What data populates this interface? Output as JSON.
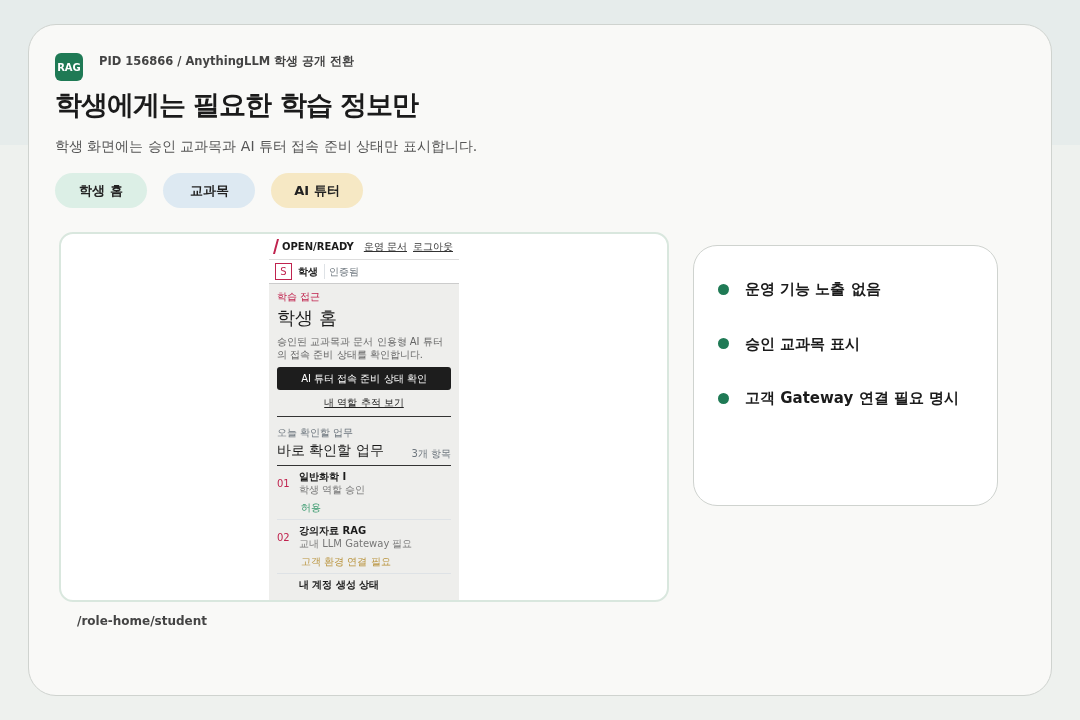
{
  "header": {
    "badge": "RAG",
    "pid": "PID 156866 / AnythingLLM 학생 공개 전환",
    "title": "학생에게는 필요한 학습 정보만",
    "subtitle": "학생 화면에는 승인 교과목과 AI 튜터 접속 준비 상태만 표시합니다.",
    "chips": [
      {
        "label": "학생 홈",
        "color": "#dcefe6"
      },
      {
        "label": "교과목",
        "color": "#dde9f2"
      },
      {
        "label": "AI 튜터",
        "color": "#f6e8c4"
      }
    ]
  },
  "preview": {
    "brand": "OPEN/READY",
    "links": [
      "운영 문서",
      "로그아웃"
    ],
    "avatar": "S",
    "role": "학생",
    "role_tag": "인증됨",
    "eyebrow": "학습 접근",
    "heading": "학생 홈",
    "description": "승인된 교과목과 문서 인용형 AI 튜터의 접속 준비 상태를 확인합니다.",
    "primary_button": "AI 튜터 접속 준비 상태 확인",
    "secondary_link": "내 역할 추적 보기",
    "tasks": {
      "eyebrow": "오늘 확인할 업무",
      "title": "바로 확인할 업무",
      "count": "3개 항목",
      "items": [
        {
          "number": "01",
          "title": "일반화학 I",
          "subtitle": "학생 역할 승인",
          "tag": "허용",
          "kind": "allowed"
        },
        {
          "number": "02",
          "title": "강의자료 RAG",
          "subtitle": "교내 LLM Gateway 필요",
          "tag": "고객 환경 연결 필요",
          "kind": "pending"
        },
        {
          "title": "내 계정 생성 상태"
        }
      ]
    },
    "path": "/role-home/student"
  },
  "checklist": [
    {
      "label": "운영 기능 노출 없음"
    },
    {
      "label": "승인 교과목 표시"
    },
    {
      "label": "고객 Gateway 연결 필요 명시"
    }
  ]
}
